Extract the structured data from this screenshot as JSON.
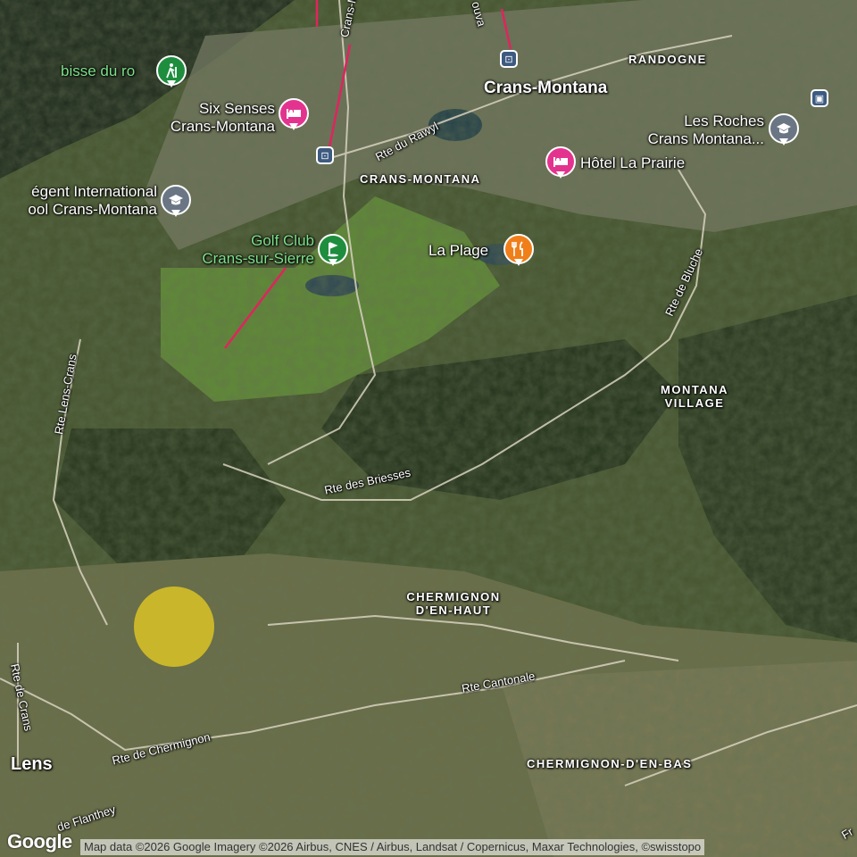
{
  "places": {
    "crans_montana_major": "Crans-Montana",
    "randogne": "RANDOGNE",
    "crans_montana_small": "CRANS-MONTANA",
    "montana_village": "MONTANA\nVILLAGE",
    "chermignon_en_haut": "CHERMIGNON\nD'EN-HAUT",
    "chermignon_en_bas": "CHERMIGNON-D'EN-BAS",
    "lens": "Lens"
  },
  "roads": {
    "crans_m": "Crans-M",
    "ouva": "ouva",
    "rte_du_rawyl": "Rte du Rawyl",
    "rte_de_bluche": "Rte de Bluche",
    "rte_lens_crans": "Rte Lens-Crans",
    "rte_des_briesses": "Rte des Briesses",
    "rte_cantonale": "Rte Cantonale",
    "rte_de_chermignon": "Rte de Chermignon",
    "rte_de_crans": "Rte de Crans",
    "de_flanthey": "de Flanthey",
    "fr": "Fr"
  },
  "pois": [
    {
      "id": "bisse-du-ro",
      "label": "bisse du ro",
      "icon": "hiking-icon",
      "color": "#1e8e3e"
    },
    {
      "id": "six-senses",
      "label": "Six Senses\nCrans-Montana",
      "icon": "hotel-bed-icon",
      "color": "#e4338f"
    },
    {
      "id": "regent-school",
      "label": "égent International\nool Crans-Montana",
      "icon": "school-icon",
      "color": "#5f6b7a"
    },
    {
      "id": "golf-club",
      "label": "Golf Club\nCrans-sur-Sierre",
      "icon": "golf-icon",
      "color": "#1e8e3e"
    },
    {
      "id": "hotel-la-prairie",
      "label": "Hôtel La Prairie",
      "icon": "hotel-bed-icon",
      "color": "#e4338f"
    },
    {
      "id": "la-plage",
      "label": "La Plage",
      "icon": "restaurant-icon",
      "color": "#f07f1a"
    },
    {
      "id": "les-roches",
      "label": "Les Roches\nCrans Montana...",
      "icon": "school-icon",
      "color": "#5f6b7a"
    }
  ],
  "attribution": {
    "logo": "Google",
    "text": "Map data ©2026 Google Imagery ©2026 Airbus, CNES / Airbus, Landsat / Copernicus, Maxar Technologies, ©swisstopo"
  }
}
